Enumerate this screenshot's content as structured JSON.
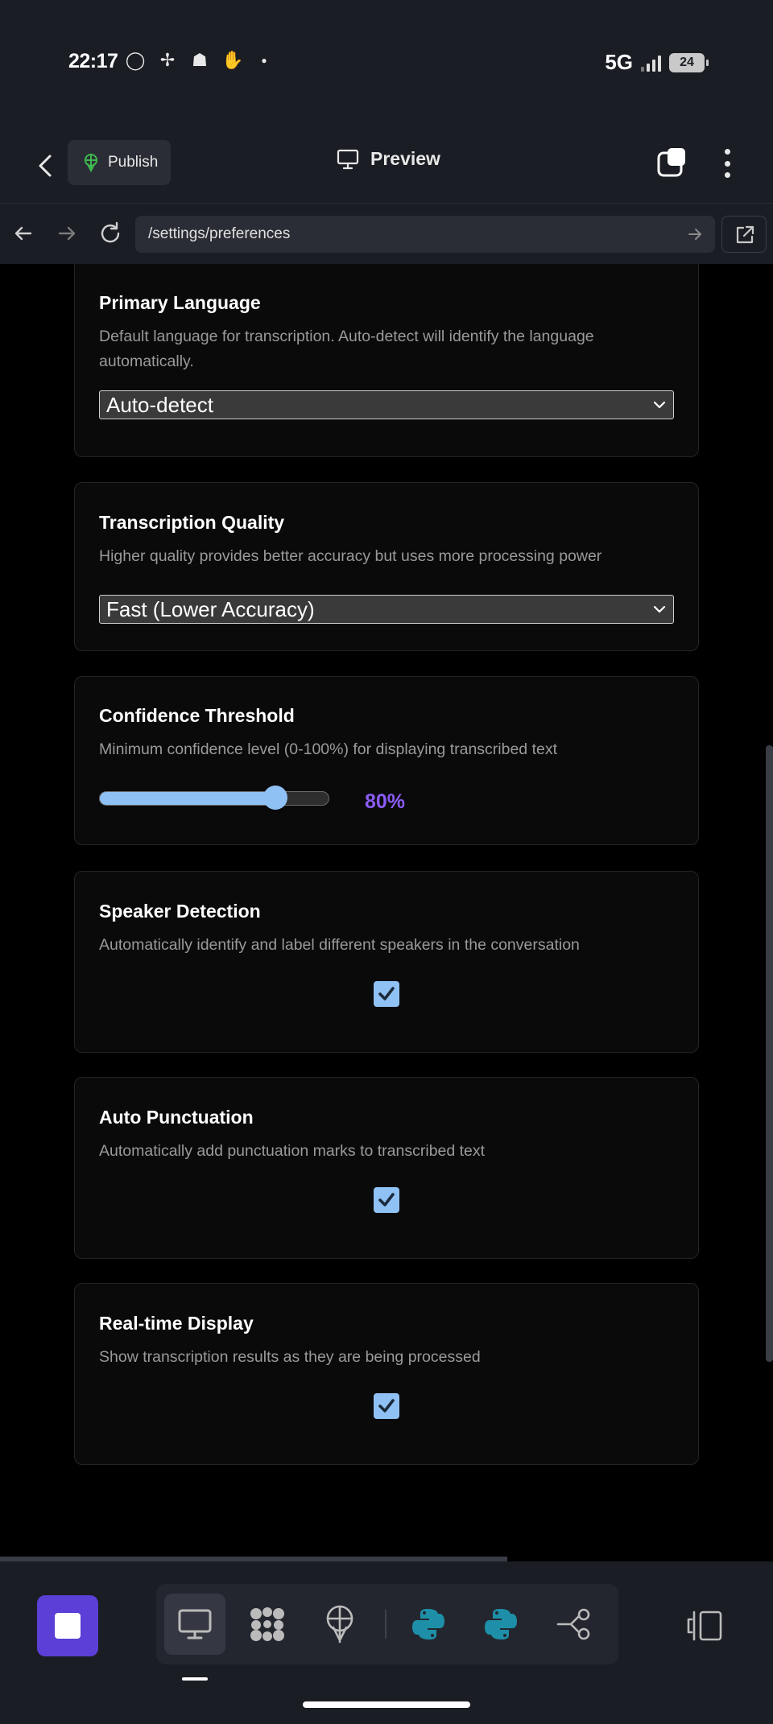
{
  "status_bar": {
    "time": "22:17",
    "network": "5G",
    "battery": "24",
    "notification_icons": [
      "whatsapp-icon",
      "slack-icon",
      "snapchat-icon",
      "hand-icon",
      "dot-icon"
    ]
  },
  "app_bar": {
    "publish_label": "Publish",
    "preview_label": "Preview"
  },
  "url_bar": {
    "url": "/settings/preferences"
  },
  "settings": {
    "primary_language": {
      "title": "Primary Language",
      "description": "Default language for transcription. Auto-detect will identify the language automatically.",
      "value": "Auto-detect"
    },
    "transcription_quality": {
      "title": "Transcription Quality",
      "description": "Higher quality provides better accuracy but uses more processing power",
      "value": "Fast (Lower Accuracy)"
    },
    "confidence_threshold": {
      "title": "Confidence Threshold",
      "description": "Minimum confidence level (0-100%) for displaying transcribed text",
      "value": 80,
      "value_label": "80%"
    },
    "speaker_detection": {
      "title": "Speaker Detection",
      "description": "Automatically identify and label different speakers in the conversation",
      "checked": true
    },
    "auto_punctuation": {
      "title": "Auto Punctuation",
      "description": "Automatically add punctuation marks to transcribed text",
      "checked": true
    },
    "realtime_display": {
      "title": "Real-time Display",
      "description": "Show transcription results as they are being processed",
      "checked": true
    }
  },
  "colors": {
    "accent_purple": "#8b5cf6",
    "control_blue": "#8fc1f5",
    "stop_button": "#5b3fd6"
  },
  "toolbar": {
    "tools": [
      "desktop-icon",
      "grid-icon",
      "deploy-icon",
      "python-icon",
      "python-icon",
      "share-icon"
    ]
  }
}
